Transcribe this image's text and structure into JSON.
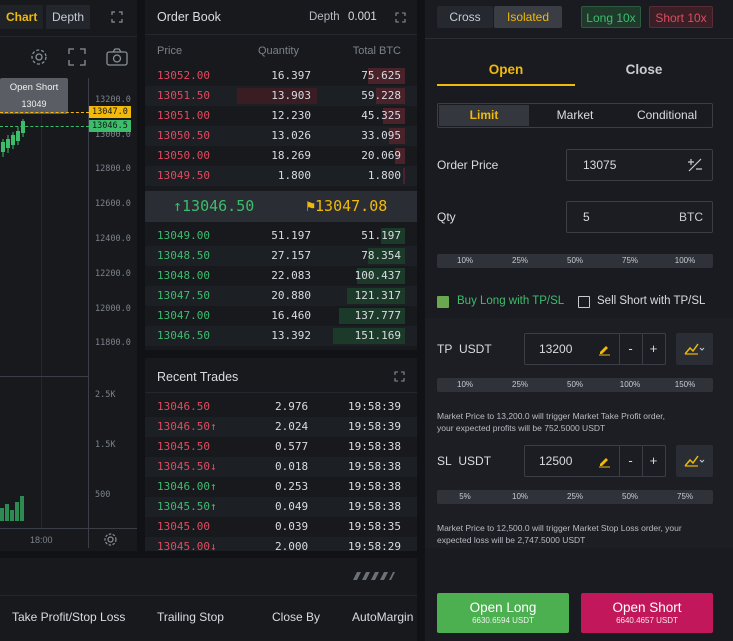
{
  "chart": {
    "tab_chart": "Chart",
    "tab_depth": "Depth",
    "open_short_label": "Open Short",
    "open_short_price": "13049",
    "price_tag_top": "13047.0",
    "price_tag_bottom": "13046.5",
    "y_ticks": [
      "13200.0",
      "13000.0",
      "12800.0",
      "12600.0",
      "12400.0",
      "12200.0",
      "12000.0",
      "11800.0"
    ],
    "volume_ticks": [
      "2.5K",
      "1.5K",
      "500"
    ],
    "x_tick": "18:00",
    "icons": [
      "expand-icon",
      "settings-icon",
      "fullscreen-icon",
      "camera-icon",
      "gear-icon"
    ]
  },
  "orderbook": {
    "title": "Order Book",
    "depth_label": "Depth",
    "depth_value": "0.001",
    "col_price": "Price",
    "col_qty": "Quantity",
    "col_total": "Total BTC",
    "asks": [
      {
        "price": "13052.00",
        "qty": "16.397",
        "total": "75.625",
        "depth": 0.46
      },
      {
        "price": "13051.50",
        "qty": "13.903",
        "total": "59.228",
        "depth": 0.36
      },
      {
        "price": "13051.00",
        "qty": "12.230",
        "total": "45.325",
        "depth": 0.28
      },
      {
        "price": "13050.50",
        "qty": "13.026",
        "total": "33.095",
        "depth": 0.2
      },
      {
        "price": "13050.00",
        "qty": "18.269",
        "total": "20.069",
        "depth": 0.12
      },
      {
        "price": "13049.50",
        "qty": "1.800",
        "total": "1.800",
        "depth": 0.02
      }
    ],
    "last_price": "13046.50",
    "mark_price": "13047.08",
    "bids": [
      {
        "price": "13049.00",
        "qty": "51.197",
        "total": "51.197",
        "depth": 0.3
      },
      {
        "price": "13048.50",
        "qty": "27.157",
        "total": "78.354",
        "depth": 0.46
      },
      {
        "price": "13048.00",
        "qty": "22.083",
        "total": "100.437",
        "depth": 0.6
      },
      {
        "price": "13047.50",
        "qty": "20.880",
        "total": "121.317",
        "depth": 0.72
      },
      {
        "price": "13047.00",
        "qty": "16.460",
        "total": "137.777",
        "depth": 0.82
      },
      {
        "price": "13046.50",
        "qty": "13.392",
        "total": "151.169",
        "depth": 0.9
      }
    ]
  },
  "trades": {
    "title": "Recent Trades",
    "rows": [
      {
        "price": "13046.50",
        "arrow": "",
        "side": "sell",
        "qty": "2.976",
        "time": "19:58:39"
      },
      {
        "price": "13046.50",
        "arrow": "↑",
        "side": "sell",
        "qty": "2.024",
        "time": "19:58:39"
      },
      {
        "price": "13045.50",
        "arrow": "",
        "side": "sell",
        "qty": "0.577",
        "time": "19:58:38"
      },
      {
        "price": "13045.50",
        "arrow": "↓",
        "side": "sell",
        "qty": "0.018",
        "time": "19:58:38"
      },
      {
        "price": "13046.00",
        "arrow": "↑",
        "side": "buy",
        "qty": "0.253",
        "time": "19:58:38"
      },
      {
        "price": "13045.50",
        "arrow": "↑",
        "side": "buy",
        "qty": "0.049",
        "time": "19:58:38"
      },
      {
        "price": "13045.00",
        "arrow": "",
        "side": "sell",
        "qty": "0.039",
        "time": "19:58:35"
      },
      {
        "price": "13045.00",
        "arrow": "↓",
        "side": "sell",
        "qty": "2.000",
        "time": "19:58:29"
      }
    ]
  },
  "trade_panel": {
    "margin_cross": "Cross",
    "margin_isolated": "Isolated",
    "long_lev": "Long 10x",
    "short_lev": "Short 10x",
    "tab_open": "Open",
    "tab_close": "Close",
    "type_limit": "Limit",
    "type_market": "Market",
    "type_conditional": "Conditional",
    "order_price_label": "Order Price",
    "order_price_value": "13075",
    "qty_label": "Qty",
    "qty_value": "5",
    "qty_unit": "BTC",
    "qty_pcts": [
      "10%",
      "25%",
      "50%",
      "75%",
      "100%"
    ],
    "buy_long_tpsl": "Buy Long with TP/SL",
    "sell_short_tpsl": "Sell Short with TP/SL",
    "tp_label": "TP",
    "tp_unit": "USDT",
    "tp_value": "13200",
    "tp_pcts": [
      "10%",
      "25%",
      "50%",
      "100%",
      "150%"
    ],
    "tp_note_1": "Market Price to 13,200.0 will trigger Market Take Profit order,",
    "tp_note_2": "your expected profits will be 752.5000 USDT",
    "sl_label": "SL",
    "sl_unit": "USDT",
    "sl_value": "12500",
    "sl_pcts": [
      "5%",
      "10%",
      "25%",
      "50%",
      "75%"
    ],
    "sl_note_1": "Market Price to 12,500.0 will trigger Market Stop Loss order, your",
    "sl_note_2": "expected loss will be 2,747.5000 USDT",
    "open_long": "Open Long",
    "open_long_cost": "6630.6594 USDT",
    "open_short": "Open Short",
    "open_short_cost": "6640.4657 USDT",
    "stepper_minus": "-",
    "stepper_plus": "+"
  },
  "bottom_tabs": {
    "tpsl": "Take Profit/Stop Loss",
    "trailing": "Trailing Stop",
    "close_by": "Close By",
    "auto_margin": "AutoMargin"
  },
  "colors": {
    "accent": "#f0b90b",
    "buy": "#3dbd6c",
    "sell": "#e24a5e"
  }
}
